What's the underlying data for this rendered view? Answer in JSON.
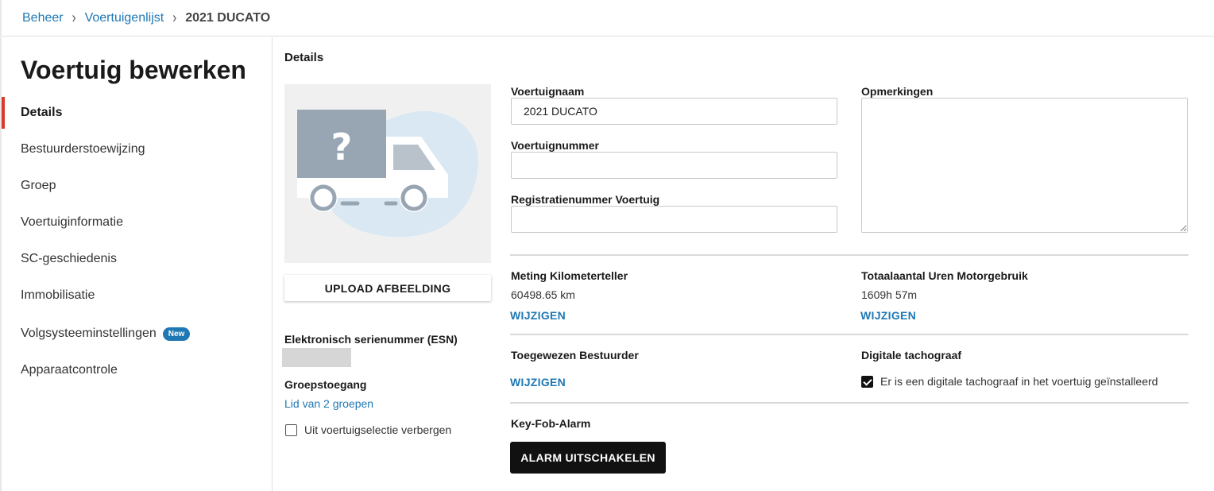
{
  "breadcrumb": {
    "items": [
      "Beheer",
      "Voertuigenlijst"
    ],
    "current": "2021 DUCATO"
  },
  "sidebar": {
    "title": "Voertuig bewerken",
    "items": [
      {
        "label": "Details",
        "active": true
      },
      {
        "label": "Bestuurderstoewijzing"
      },
      {
        "label": "Groep"
      },
      {
        "label": "Voertuiginformatie"
      },
      {
        "label": "SC-geschiedenis"
      },
      {
        "label": "Immobilisatie"
      },
      {
        "label": "Volgsysteeminstellingen",
        "badge": "New"
      },
      {
        "label": "Apparaatcontrole"
      }
    ]
  },
  "details": {
    "section_title": "Details",
    "upload_label": "UPLOAD AFBEELDING",
    "esn_label": "Elektronisch serienummer (ESN)",
    "group_access_label": "Groepstoegang",
    "group_link": "Lid van 2 groepen",
    "hide_label": "Uit voertuigselectie verbergen",
    "hide_checked": false
  },
  "form": {
    "name_label": "Voertuignaam",
    "name_value": "2021 DUCATO",
    "number_label": "Voertuignummer",
    "number_value": "",
    "reg_label": "Registratienummer Voertuig",
    "reg_value": "",
    "remarks_label": "Opmerkingen",
    "remarks_value": ""
  },
  "odometer": {
    "label": "Meting Kilometerteller",
    "value": "60498.65 km",
    "action": "WIJZIGEN"
  },
  "engine_hours": {
    "label": "Totaalaantal Uren Motorgebruik",
    "value": "1609h 57m",
    "action": "WIJZIGEN"
  },
  "driver": {
    "label": "Toegewezen Bestuurder",
    "action": "WIJZIGEN"
  },
  "tachograph": {
    "label": "Digitale tachograaf",
    "checkbox_label": "Er is een digitale tachograaf in het voertuig geïnstalleerd",
    "checked": true
  },
  "keyfob": {
    "label": "Key-Fob-Alarm",
    "button": "ALARM UITSCHAKELEN"
  },
  "colors": {
    "accent": "#1f78b4",
    "active_indicator": "#d93a2b",
    "truck_body": "#98a6b4",
    "truck_bg_blob": "#d9e8f2"
  }
}
